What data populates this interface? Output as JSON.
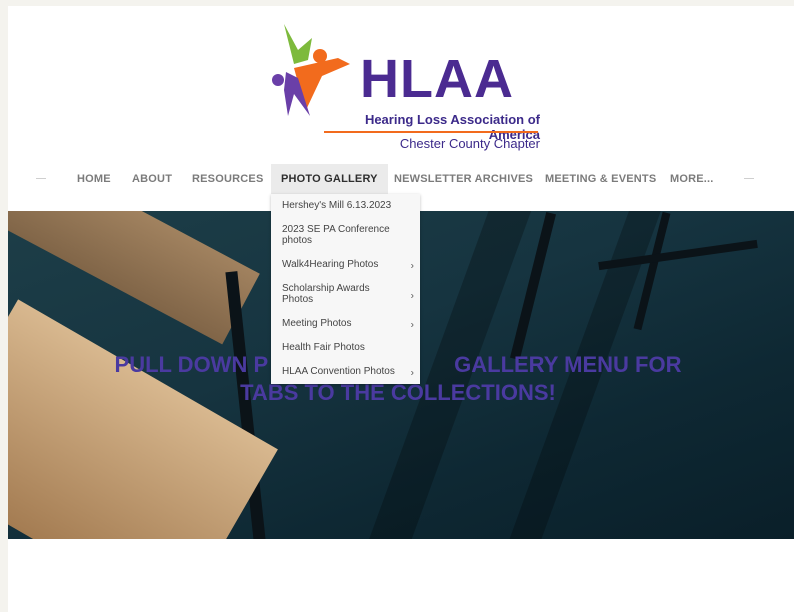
{
  "logo": {
    "title": "HLAA",
    "subtitle": "Hearing Loss Association of America",
    "chapter": "Chester County Chapter"
  },
  "nav": {
    "items": [
      {
        "label": "HOME"
      },
      {
        "label": "ABOUT"
      },
      {
        "label": "RESOURCES"
      },
      {
        "label": "PHOTO GALLERY",
        "active": true
      },
      {
        "label": "NEWSLETTER ARCHIVES"
      },
      {
        "label": "MEETING & EVENTS"
      },
      {
        "label": "MORE..."
      }
    ]
  },
  "dropdown": {
    "items": [
      {
        "label": "Hershey's Mill 6.13.2023",
        "has_submenu": false
      },
      {
        "label": "2023 SE PA Conference photos",
        "has_submenu": false
      },
      {
        "label": "Walk4Hearing Photos",
        "has_submenu": true
      },
      {
        "label": "Scholarship Awards Photos",
        "has_submenu": true
      },
      {
        "label": "Meeting Photos",
        "has_submenu": true
      },
      {
        "label": "Health Fair Photos",
        "has_submenu": false
      },
      {
        "label": "HLAA Convention Photos",
        "has_submenu": true
      }
    ],
    "submenu_arrow": "›"
  },
  "hero": {
    "line1_visible_left": "PULL DOWN P",
    "line1_visible_right": "GALLERY  MENU FOR",
    "line2": "TABS TO THE COLLECTIONS!"
  },
  "colors": {
    "logo_purple": "#4b2b91",
    "logo_orange": "#f26b1d",
    "logo_green": "#7dba3c",
    "hero_text": "#4a3aa0"
  }
}
